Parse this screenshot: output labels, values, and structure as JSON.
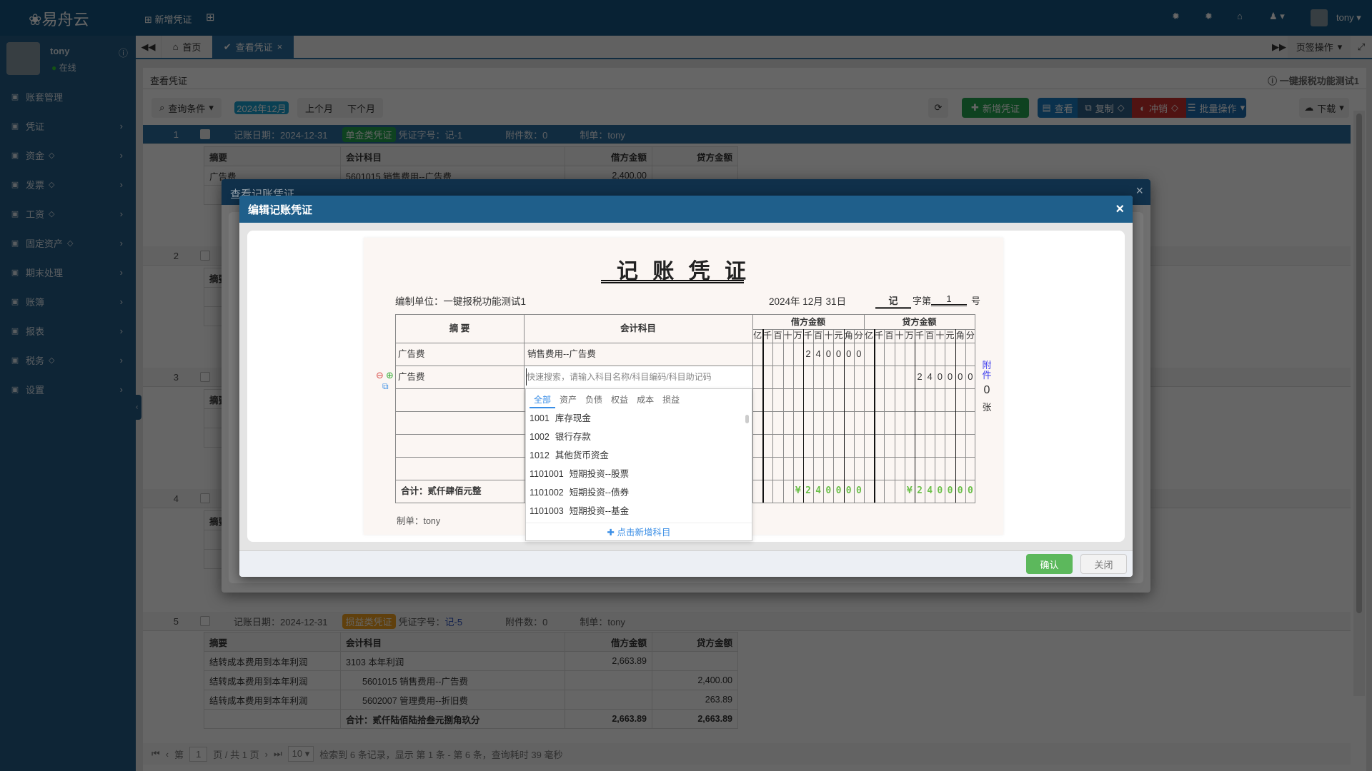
{
  "topbar": {
    "logo": "易舟云",
    "new_voucher": "新增凭证",
    "user": "tony"
  },
  "sidebar": {
    "user": "tony",
    "status": "在线",
    "items": [
      {
        "label": "账套管理",
        "icon": "archive-icon",
        "premium": false,
        "chevron": false
      },
      {
        "label": "凭证",
        "icon": "voucher-icon",
        "premium": false,
        "chevron": true
      },
      {
        "label": "资金",
        "icon": "money-icon",
        "premium": true,
        "chevron": true
      },
      {
        "label": "发票",
        "icon": "invoice-icon",
        "premium": true,
        "chevron": true
      },
      {
        "label": "工资",
        "icon": "card-icon",
        "premium": true,
        "chevron": true
      },
      {
        "label": "固定资产",
        "icon": "building-icon",
        "premium": true,
        "chevron": true
      },
      {
        "label": "期末处理",
        "icon": "calendar-icon",
        "premium": false,
        "chevron": true
      },
      {
        "label": "账簿",
        "icon": "book-icon",
        "premium": false,
        "chevron": true
      },
      {
        "label": "报表",
        "icon": "chart-icon",
        "premium": false,
        "chevron": true
      },
      {
        "label": "税务",
        "icon": "tax-icon",
        "premium": true,
        "chevron": true
      },
      {
        "label": "设置",
        "icon": "gear-icon",
        "premium": false,
        "chevron": true
      }
    ]
  },
  "tabs": {
    "home": "首页",
    "active": "查看凭证",
    "tab_ops": "页签操作"
  },
  "page": {
    "title": "查看凭证",
    "company": "一键报税功能测试1"
  },
  "toolbar": {
    "query": "查询条件",
    "period": "2024年12月",
    "prev": "上个月",
    "next": "下个月",
    "add": "新增凭证",
    "view": "查看",
    "copy": "复制",
    "reverse": "冲销",
    "batch": "批量操作",
    "download": "下载"
  },
  "colors": {
    "accent": "#1f5f8b",
    "green": "#5cb85c",
    "sum_green": "#6cc04a",
    "pl_badge": "#f0a020"
  },
  "list": {
    "headers": [
      "摘要",
      "会计科目",
      "借方金额",
      "贷方金额"
    ],
    "v1": {
      "no": "1",
      "date": "记账日期：2024-12-31",
      "type": "单金类凭证",
      "code": "凭证字号：记-1",
      "att": "附件数：0",
      "maker": "制单：tony",
      "row": [
        "广告费",
        "5601015 销售费用--广告费",
        "2,400.00",
        ""
      ]
    },
    "v2": {
      "no": "2"
    },
    "v3": {
      "no": "3"
    },
    "v4": {
      "no": "4"
    },
    "v5": {
      "no": "5",
      "date": "记账日期：2024-12-31",
      "type": "损益类凭证",
      "code_label": "凭证字号：",
      "code": "记-5",
      "att": "附件数：0",
      "maker": "制单：tony",
      "rows": [
        [
          "结转成本费用到本年利润",
          "3103 本年利润",
          "2,663.89",
          ""
        ],
        [
          "结转成本费用到本年利润",
          "5601015 销售费用--广告费",
          "",
          "2,400.00"
        ],
        [
          "结转成本费用到本年利润",
          "5602007 管理费用--折旧费",
          "",
          "263.89"
        ]
      ],
      "total": [
        "合计：贰仟陆佰陆拾叁元捌角玖分",
        "2,663.89",
        "2,663.89"
      ]
    }
  },
  "pagination": {
    "page_label": "第",
    "page": "1",
    "of": "页 / 共 1 页",
    "size": "10",
    "info": "检索到 6 条记录，显示 第 1 条 - 第 6 条，查询耗时 39 毫秒"
  },
  "outer_modal": {
    "title": "查看记账凭证"
  },
  "modal": {
    "title": "编辑记账凭证",
    "confirm": "确认",
    "close": "关闭"
  },
  "voucher": {
    "title": "记 账 凭 证",
    "unit": "编制单位：一键报税功能测试1",
    "date": "2024年 12月 31日",
    "word": "记",
    "word_label": "字第",
    "number": "1",
    "number_label": "号",
    "col_summary": "摘 要",
    "col_account": "会计科目",
    "col_debit": "借方金额",
    "col_credit": "贷方金额",
    "units": [
      "亿",
      "千",
      "百",
      "十",
      "万",
      "千",
      "百",
      "十",
      "元",
      "角",
      "分"
    ],
    "rows": [
      {
        "summary": "广告费",
        "account": "销售费用--广告费",
        "debit": "240000",
        "credit": ""
      },
      {
        "summary": "广告费",
        "account": "",
        "debit": "",
        "credit": "240000",
        "editing": true
      },
      {
        "summary": "",
        "account": "",
        "debit": "",
        "credit": ""
      },
      {
        "summary": "",
        "account": "",
        "debit": "",
        "credit": ""
      },
      {
        "summary": "",
        "account": "",
        "debit": "",
        "credit": ""
      },
      {
        "summary": "",
        "account": "",
        "debit": "",
        "credit": ""
      }
    ],
    "total_label": "合计：贰仟肆佰元整",
    "total_debit": "¥240000",
    "total_credit": "¥240000",
    "attach_label": "附件",
    "attach_count": "0",
    "attach_unit": "张",
    "maker": "制单：tony",
    "search_placeholder": "快速搜索，请输入科目名称/科目编码/科目助记码"
  },
  "dropdown": {
    "tabs": [
      "全部",
      "资产",
      "负债",
      "权益",
      "成本",
      "损益"
    ],
    "active_tab": 0,
    "items": [
      [
        "1001",
        "库存现金"
      ],
      [
        "1002",
        "银行存款"
      ],
      [
        "1012",
        "其他货币资金"
      ],
      [
        "1101001",
        "短期投资--股票"
      ],
      [
        "1101002",
        "短期投资--债券"
      ],
      [
        "1101003",
        "短期投资--基金"
      ]
    ],
    "add": "点击新增科目"
  }
}
